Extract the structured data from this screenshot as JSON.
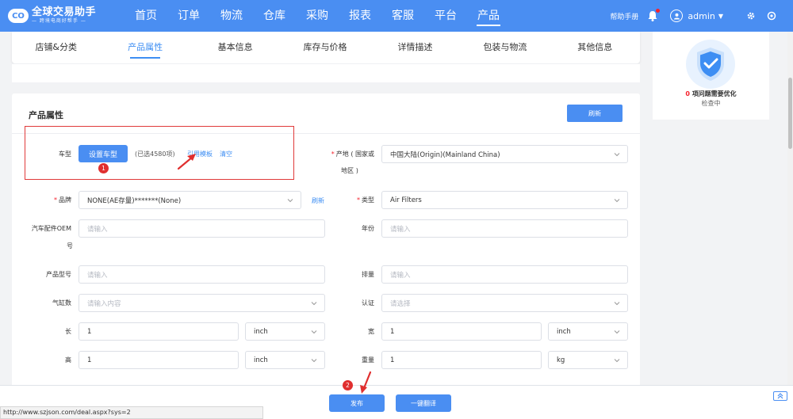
{
  "brand": {
    "mark": "CO",
    "title": "全球交易助手",
    "subtitle": "— 跨境电商好帮手 —"
  },
  "nav": [
    "首页",
    "订单",
    "物流",
    "仓库",
    "采购",
    "报表",
    "客服",
    "平台",
    "产品"
  ],
  "nav_active_index": 8,
  "top_right": {
    "help": "帮助手册",
    "user": "admin"
  },
  "tabs": [
    "店铺&分类",
    "产品属性",
    "基本信息",
    "库存与价格",
    "详情描述",
    "包装与物流",
    "其他信息"
  ],
  "tabs_active_index": 1,
  "side_panel": {
    "count": "0",
    "message": "项问题需要优化",
    "status": "检查中"
  },
  "card": {
    "title": "产品属性",
    "refresh_button": "刷新"
  },
  "form": {
    "car_model": {
      "label": "车型",
      "button": "设置车型",
      "selected": "(已选4580项)",
      "template_link": "引用模板",
      "clear_link": "清空",
      "step": "1"
    },
    "origin": {
      "label_line1": "产地 ( 国家或",
      "label_line2": "地区 )",
      "value": "中国大陆(Origin)(Mainland China)"
    },
    "brand": {
      "label": "品牌",
      "value": "NONE(AE存量)*******(None)",
      "refresh": "刷新"
    },
    "type": {
      "label": "类型",
      "value": "Air Filters"
    },
    "oem": {
      "label_line1": "汽车配件OEM",
      "label_line2": "号",
      "placeholder": "请输入"
    },
    "year": {
      "label": "年份",
      "placeholder": "请输入"
    },
    "product_model": {
      "label": "产品型号",
      "placeholder": "请输入"
    },
    "displacement": {
      "label": "排量",
      "placeholder": "请输入"
    },
    "cylinders": {
      "label": "气缸数",
      "placeholder": "请输入内容"
    },
    "certification": {
      "label": "认证",
      "placeholder": "请选择"
    },
    "length": {
      "label": "长",
      "value": "1",
      "unit": "inch"
    },
    "width": {
      "label": "宽",
      "value": "1",
      "unit": "inch"
    },
    "height": {
      "label": "高",
      "value": "1",
      "unit": "inch"
    },
    "weight": {
      "label": "重量",
      "value": "1",
      "unit": "kg"
    }
  },
  "bottom": {
    "publish": "发布",
    "translate": "一键翻译",
    "step": "2",
    "status_url": "http://www.szjson.com/deal.aspx?sys=2"
  },
  "colors": {
    "primary": "#4a8ef2",
    "highlight": "#e03a3a",
    "required": "#f5222d"
  }
}
